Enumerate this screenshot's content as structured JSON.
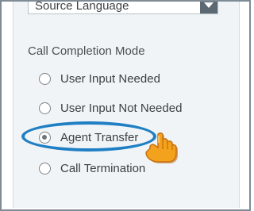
{
  "source_language": {
    "value": "Source Language",
    "chevron_icon": "chevron-down-icon"
  },
  "call_completion": {
    "title": "Call Completion Mode",
    "options": [
      {
        "label": "User Input Needed",
        "checked": false
      },
      {
        "label": "User Input Not Needed",
        "checked": false
      },
      {
        "label": "Agent Transfer",
        "checked": true
      },
      {
        "label": "Call Termination",
        "checked": false
      }
    ],
    "highlight_color": "#1f7fc4",
    "pointer_icon": "hand-pointer-icon",
    "pointer_color": "#f2a21d"
  }
}
